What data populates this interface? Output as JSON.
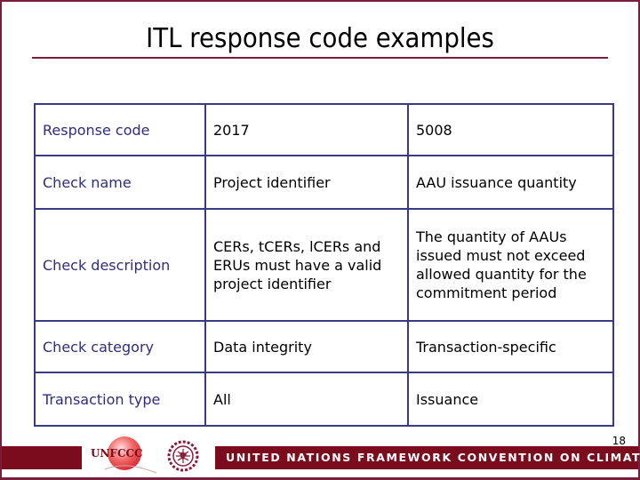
{
  "slide": {
    "title": "ITL response code examples",
    "page_number": "18"
  },
  "table": {
    "rows": [
      {
        "label": "Response code",
        "col1": "2017",
        "col2": "5008"
      },
      {
        "label": "Check name",
        "col1": "Project identifier",
        "col2": "AAU issuance quantity"
      },
      {
        "label": "Check description",
        "col1": "CERs, tCERs, lCERs and ERUs must have a valid project identifier",
        "col2": "The quantity of AAUs issued must not exceed allowed quantity for the commitment period"
      },
      {
        "label": "Check category",
        "col1": "Data integrity",
        "col2": "Transaction-specific"
      },
      {
        "label": "Transaction type",
        "col1": "All",
        "col2": "Issuance"
      }
    ]
  },
  "footer": {
    "logo_text": "UNFCCC",
    "banner_text": "UNITED NATIONS FRAMEWORK CONVENTION ON CLIMATE CHANGE",
    "emblem": "un-emblem-icon"
  },
  "colors": {
    "accent": "#7a1d3c",
    "banner": "#7a0c1e",
    "table_border": "#3a3a82",
    "label_text": "#2e2e7a"
  }
}
